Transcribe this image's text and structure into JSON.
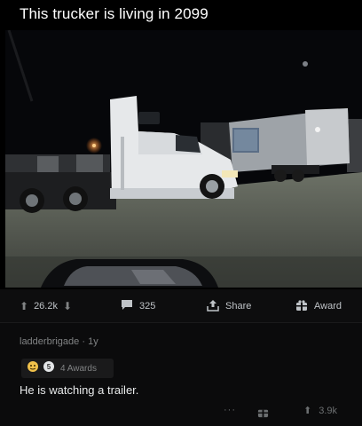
{
  "post": {
    "title": "This trucker is living in 2099"
  },
  "actions": {
    "upvotes": "26.2k",
    "comments": "325",
    "share_label": "Share",
    "award_label": "Award"
  },
  "comment": {
    "author": "ladderbrigade",
    "separator": "·",
    "age": "1y",
    "awards_label": "4 Awards",
    "award_badge_number": "5",
    "body": "He is watching a trailer.",
    "more": "···",
    "score": "3.9k"
  },
  "colors": {
    "background": "#000000",
    "bar": "#0d0d0e",
    "muted_text": "#818384",
    "truck_white": "#e6e8ea",
    "trailer_screen": "#5b6e86"
  }
}
